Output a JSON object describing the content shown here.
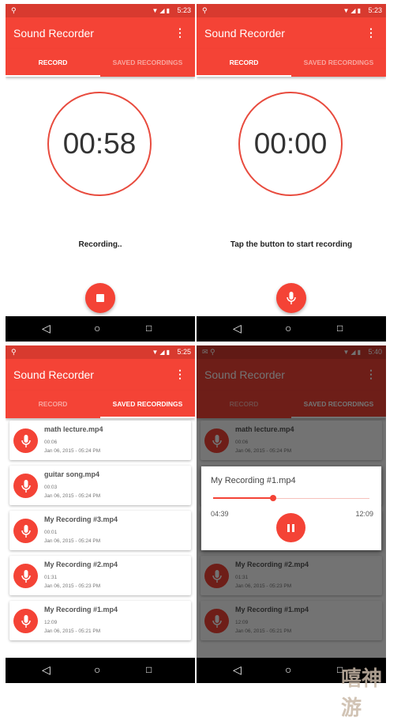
{
  "app_title": "Sound Recorder",
  "tabs": [
    "RECORD",
    "SAVED RECORDINGS"
  ],
  "colors": {
    "primary": "#f44336",
    "status_bar": "#d83a2f"
  },
  "screens": [
    {
      "status_time": "5:23",
      "timer": "00:58",
      "message": "Recording..",
      "fab_icon": "stop-icon",
      "active_tab": 0
    },
    {
      "status_time": "5:23",
      "timer": "00:00",
      "message": "Tap the button to start recording",
      "fab_icon": "mic-icon",
      "active_tab": 0
    },
    {
      "status_time": "5:25",
      "active_tab": 1
    },
    {
      "status_time": "5:40",
      "active_tab": 1
    }
  ],
  "recordings": [
    {
      "name": "math lecture.mp4",
      "duration": "00:06",
      "date": "Jan 06, 2015 - 05:24 PM"
    },
    {
      "name": "guitar song.mp4",
      "duration": "00:03",
      "date": "Jan 06, 2015 - 05:24 PM"
    },
    {
      "name": "My Recording #3.mp4",
      "duration": "00:01",
      "date": "Jan 06, 2015 - 05:24 PM"
    },
    {
      "name": "My Recording #2.mp4",
      "duration": "01:31",
      "date": "Jan 06, 2015 - 05:23 PM"
    },
    {
      "name": "My Recording #1.mp4",
      "duration": "12:09",
      "date": "Jan 06, 2015 - 05:21 PM"
    }
  ],
  "player": {
    "title": "My Recording #1.mp4",
    "current": "04:39",
    "total": "12:09",
    "progress": 0.383,
    "state_icon": "pause-icon"
  },
  "watermark": "嘻神游"
}
